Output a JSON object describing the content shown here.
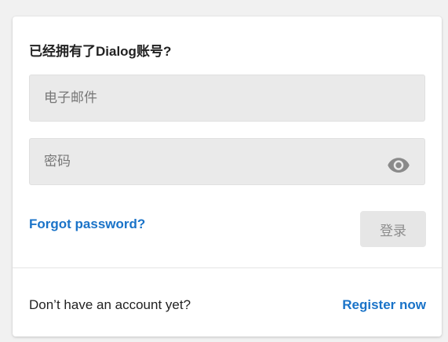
{
  "login": {
    "heading": "已经拥有了Dialog账号?",
    "email_placeholder": "电子邮件",
    "email_value": "",
    "password_placeholder": "密码",
    "password_value": "",
    "show_password_icon": "eye-icon",
    "forgot_label": "Forgot password?",
    "submit_label": "登录",
    "submit_enabled": false
  },
  "footer": {
    "prompt": "Don’t have an account yet?",
    "register_label": "Register now"
  },
  "colors": {
    "link": "#1a73c8",
    "field_bg": "#eaeaea",
    "disabled_button_bg": "#e6e6e6",
    "disabled_button_text": "#8d8d8d"
  }
}
